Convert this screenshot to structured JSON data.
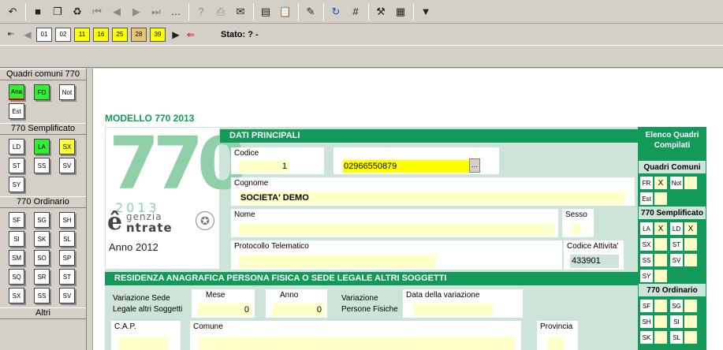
{
  "toolbar1": {
    "icons": [
      "undo-icon",
      "save-icon",
      "copy-icon",
      "recycle-icon",
      "first-icon",
      "prev-icon",
      "next-icon",
      "last-icon",
      "dots-icon",
      "help-icon",
      "print-icon",
      "stamp-icon",
      "doc-icon",
      "clipboard-icon",
      "ruler-icon",
      "refresh-icon",
      "grid-icon",
      "tools-icon",
      "calculator-icon",
      "dropdown-icon"
    ]
  },
  "toolbar2": {
    "nav_buttons": [
      "01",
      "02",
      "11",
      "16",
      "25",
      "28",
      "39"
    ],
    "stato_label": "Stato: ? -"
  },
  "sidebar": {
    "sections": [
      {
        "title": "Quadri comuni 770",
        "buttons": [
          "Ana",
          "FD",
          "Not",
          "Est"
        ]
      },
      {
        "title": "770 Semplificato",
        "buttons": [
          "LD",
          "LA",
          "SX",
          "ST",
          "SS",
          "SV",
          "SY"
        ]
      },
      {
        "title": "770 Ordinario",
        "buttons": [
          "SF",
          "SG",
          "SH",
          "SI",
          "SK",
          "SL",
          "SM",
          "SO",
          "SP",
          "SQ",
          "SR",
          "ST",
          "SX",
          "SS",
          "SV"
        ]
      },
      {
        "title": "Altri",
        "buttons": []
      }
    ]
  },
  "main": {
    "title": "MODELLO 770 2013",
    "logo": {
      "big_number": "770",
      "year_small": "2013",
      "agency_line1": "genzia",
      "agency_line2": "ntrate",
      "anno": "Anno 2012"
    },
    "dati_principali": {
      "header": "DATI PRINCIPALI",
      "codice_label": "Codice",
      "codice_value": "1",
      "cf_value": "02966550879",
      "cognome_label": "Cognome",
      "cognome_value": "SOCIETA' DEMO",
      "nome_label": "Nome",
      "nome_value": "",
      "sesso_label": "Sesso",
      "protocollo_label": "Protocollo Telematico",
      "codice_attivita_label": "Codice Attivita'",
      "codice_attivita_value": "433901"
    },
    "residenza": {
      "header": "RESIDENZA ANAGRAFICA PERSONA FISICA O SEDE LEGALE ALTRI SOGGETTI",
      "var_sede_line1": "Variazione Sede",
      "var_sede_line2": "Legale altri Soggetti",
      "mese_label": "Mese",
      "mese_value": "0",
      "anno_label": "Anno",
      "anno_value": "0",
      "var_pf_line1": "Variazione",
      "var_pf_line2": "Persone Fisiche",
      "data_var_label": "Data della variazione",
      "cap_label": "C.A.P.",
      "comune_label": "Comune",
      "provincia_label": "Provincia"
    }
  },
  "right_panel": {
    "header_line1": "Elenco Quadri",
    "header_line2": "Compilati",
    "comuni_title": "Quadri Comuni",
    "comuni_rows": [
      [
        "FR",
        "X",
        "Not",
        ""
      ],
      [
        "Est",
        "",
        "",
        ""
      ]
    ],
    "semplificato_title": "770 Semplificato",
    "semplificato_rows": [
      [
        "LA",
        "X",
        "LD",
        "X"
      ],
      [
        "SX",
        "",
        "ST",
        ""
      ],
      [
        "SS",
        "",
        "SV",
        ""
      ],
      [
        "SY",
        "",
        "",
        ""
      ]
    ],
    "ordinario_title": "770 Ordinario",
    "ordinario_rows": [
      [
        "SF",
        "",
        "SG",
        ""
      ],
      [
        "SH",
        "",
        "SI",
        ""
      ],
      [
        "SK",
        "",
        "SL",
        ""
      ]
    ]
  },
  "colors": {
    "accent_green": "#139a5a",
    "panel_green": "#cde5d8",
    "field_yellow": "#ffffc8",
    "highlight_yellow": "#ffff00"
  }
}
